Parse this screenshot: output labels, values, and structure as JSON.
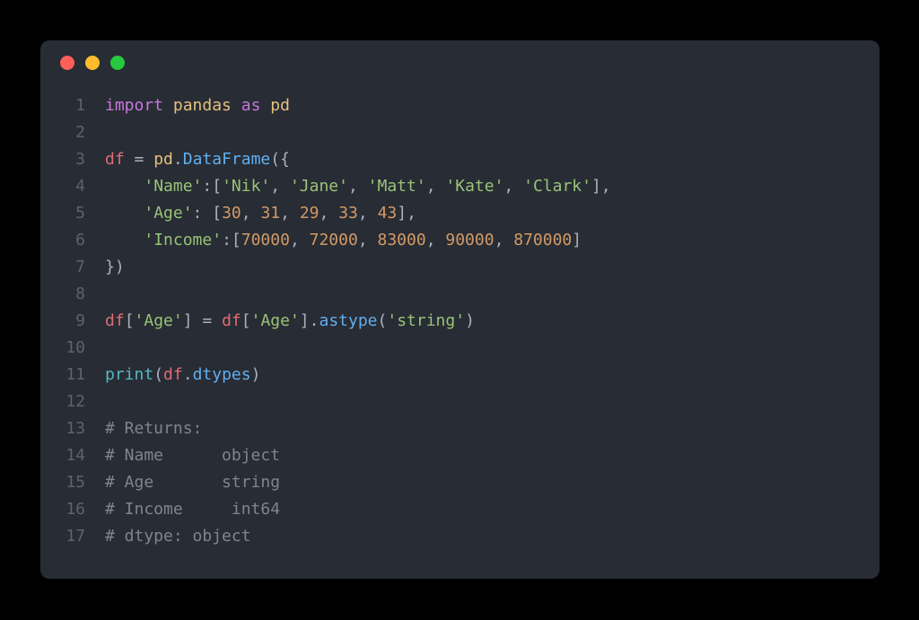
{
  "window": {
    "traffic_lights": [
      "close",
      "minimize",
      "zoom"
    ]
  },
  "code": {
    "line_numbers": [
      "1",
      "2",
      "3",
      "4",
      "5",
      "6",
      "7",
      "8",
      "9",
      "10",
      "11",
      "12",
      "13",
      "14",
      "15",
      "16",
      "17"
    ],
    "l1": {
      "import": "import",
      "pandas": "pandas",
      "as": "as",
      "pd": "pd"
    },
    "l3": {
      "df": "df",
      "eq": " = ",
      "pd": "pd",
      "dot": ".",
      "DataFrame": "DataFrame",
      "open": "({"
    },
    "l4": {
      "indent": "    ",
      "key": "'Name'",
      "colon": ":[",
      "v1": "'Nik'",
      "c1": ", ",
      "v2": "'Jane'",
      "c2": ", ",
      "v3": "'Matt'",
      "c3": ", ",
      "v4": "'Kate'",
      "c4": ", ",
      "v5": "'Clark'",
      "end": "],"
    },
    "l5": {
      "indent": "    ",
      "key": "'Age'",
      "colon": ": [",
      "n1": "30",
      "c1": ", ",
      "n2": "31",
      "c2": ", ",
      "n3": "29",
      "c3": ", ",
      "n4": "33",
      "c4": ", ",
      "n5": "43",
      "end": "],"
    },
    "l6": {
      "indent": "    ",
      "key": "'Income'",
      "colon": ":[",
      "n1": "70000",
      "c1": ", ",
      "n2": "72000",
      "c2": ", ",
      "n3": "83000",
      "c3": ", ",
      "n4": "90000",
      "c4": ", ",
      "n5": "870000",
      "end": "]"
    },
    "l7": {
      "close": "})"
    },
    "l9": {
      "df1": "df",
      "b1": "[",
      "s1": "'Age'",
      "b2": "] = ",
      "df2": "df",
      "b3": "[",
      "s2": "'Age'",
      "b4": "].",
      "astype": "astype",
      "p1": "(",
      "s3": "'string'",
      "p2": ")"
    },
    "l11": {
      "print": "print",
      "p1": "(",
      "df": "df",
      "dot": ".",
      "dtypes": "dtypes",
      "p2": ")"
    },
    "l13": {
      "text": "# Returns:"
    },
    "l14": {
      "text": "# Name      object"
    },
    "l15": {
      "text": "# Age       string"
    },
    "l16": {
      "text": "# Income     int64"
    },
    "l17": {
      "text": "# dtype: object"
    }
  }
}
